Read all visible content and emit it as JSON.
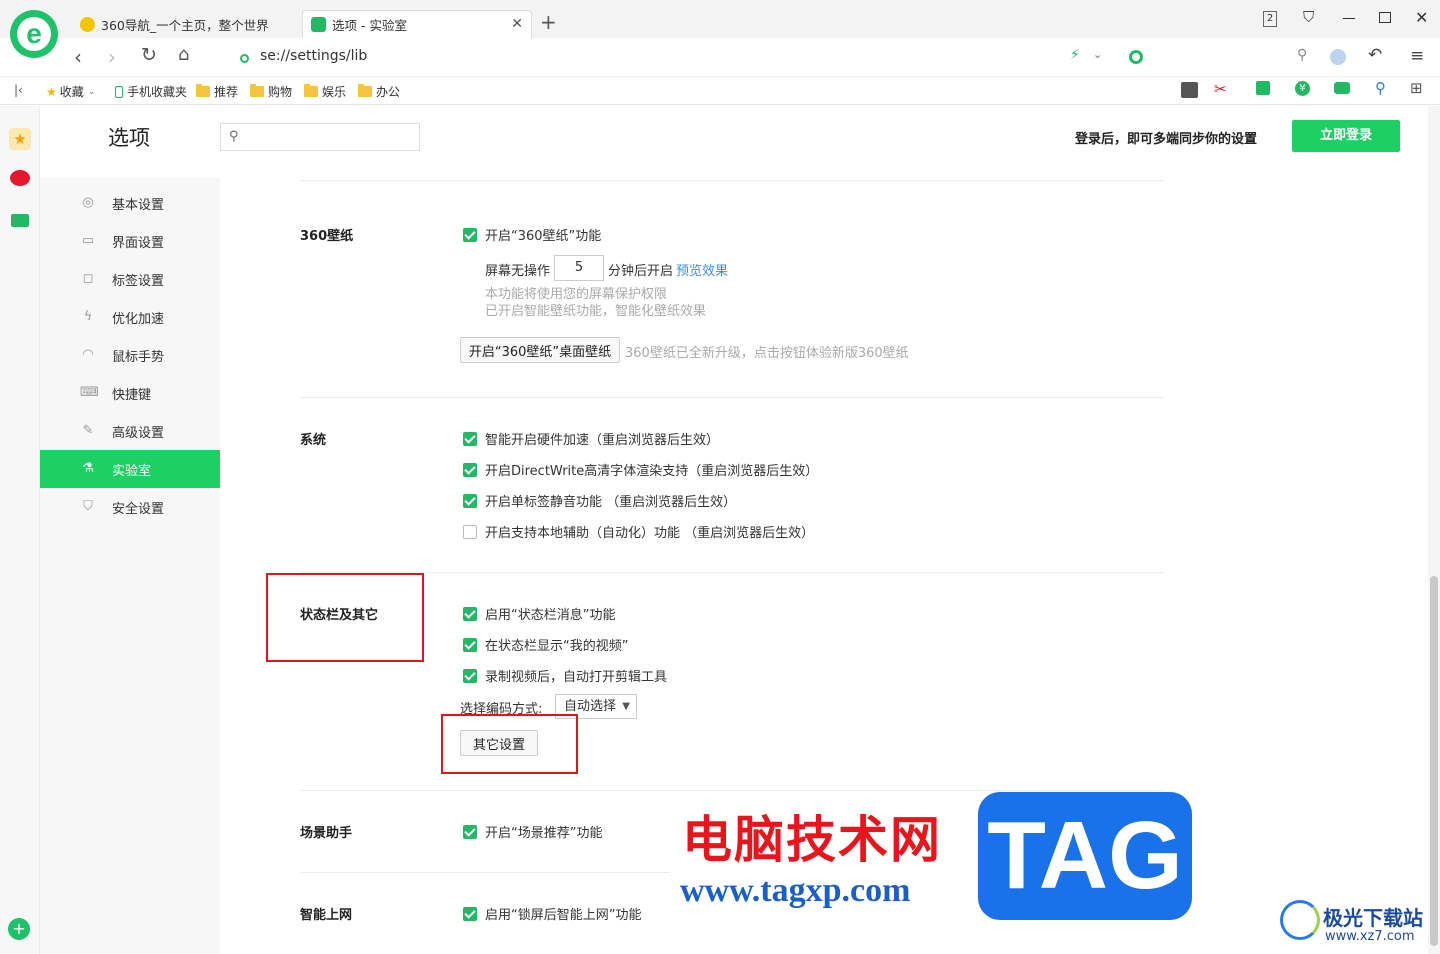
{
  "tabs": [
    {
      "title": "360导航_一个主页，整个世界"
    },
    {
      "title": "选项 - 实验室"
    }
  ],
  "window": {
    "tab_count": "2"
  },
  "address": {
    "url": "se://settings/lib"
  },
  "bookmarks": [
    {
      "label": "收藏"
    },
    {
      "label": "手机收藏夹"
    },
    {
      "label": "推荐"
    },
    {
      "label": "购物"
    },
    {
      "label": "娱乐"
    },
    {
      "label": "办公"
    }
  ],
  "header": {
    "title": "选项",
    "search_placeholder": "",
    "login_hint": "登录后，即可多端同步你的设置",
    "login_button": "立即登录"
  },
  "sidebar": {
    "items": [
      {
        "label": "基本设置",
        "icon": "gear-icon"
      },
      {
        "label": "界面设置",
        "icon": "window-icon"
      },
      {
        "label": "标签设置",
        "icon": "tab-icon"
      },
      {
        "label": "优化加速",
        "icon": "lightning-icon"
      },
      {
        "label": "鼠标手势",
        "icon": "mouse-icon"
      },
      {
        "label": "快捷键",
        "icon": "keyboard-icon"
      },
      {
        "label": "高级设置",
        "icon": "wrench-icon"
      },
      {
        "label": "实验室",
        "icon": "flask-icon"
      },
      {
        "label": "安全设置",
        "icon": "shield-icon"
      }
    ],
    "active_index": 7
  },
  "sections": {
    "wallpaper": {
      "title": "360壁纸",
      "enable": "开启“360壁纸”功能",
      "idle_prefix": "屏幕无操作",
      "idle_minutes": "5",
      "idle_suffix": "分钟后开启",
      "preview_link": "预览效果",
      "note1": "本功能将使用您的屏幕保护权限",
      "note2": "已开启智能壁纸功能，智能化壁纸效果",
      "desktop_button": "开启“360壁纸”桌面壁纸",
      "upgrade_note": "360壁纸已全新升级，点击按钮体验新版360壁纸"
    },
    "system": {
      "title": "系统",
      "options": [
        {
          "label": "智能开启硬件加速（重启浏览器后生效）",
          "checked": true
        },
        {
          "label": "开启DirectWrite高清字体渲染支持（重启浏览器后生效）",
          "checked": true
        },
        {
          "label": "开启单标签静音功能 （重启浏览器后生效）",
          "checked": true
        },
        {
          "label": "开启支持本地辅助（自动化）功能 （重启浏览器后生效）",
          "checked": false
        }
      ]
    },
    "statusbar": {
      "title": "状态栏及其它",
      "options": [
        {
          "label": "启用“状态栏消息”功能",
          "checked": true
        },
        {
          "label": "在状态栏显示“我的视频”",
          "checked": true
        },
        {
          "label": "录制视频后，自动打开剪辑工具",
          "checked": true
        }
      ],
      "encoding_label": "选择编码方式:",
      "encoding_value": "自动选择",
      "other_button": "其它设置"
    },
    "scene": {
      "title": "场景助手",
      "option": "开启“场景推荐”功能"
    },
    "smart": {
      "title": "智能上网",
      "option": "启用“锁屏后智能上网”功能"
    }
  },
  "watermark": {
    "cn": "电脑技术网",
    "url": "www.tagxp.com",
    "tag": "TAG",
    "site2": "极光下载站",
    "site2_url": "www.xz7.com"
  },
  "colors": {
    "accent": "#1ed064",
    "highlight": "#e5141c",
    "link": "#3c8fe8"
  }
}
